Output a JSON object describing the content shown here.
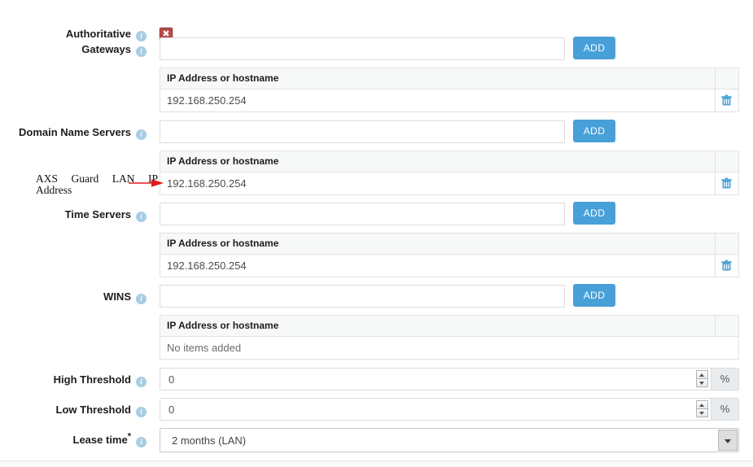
{
  "form": {
    "rows": [
      {
        "id": "authoritative",
        "label": "Authoritative",
        "type": "checkbox",
        "checked_icon": "red-x-icon",
        "accent": "#b94a48"
      },
      {
        "id": "gateways",
        "label": "Gateways",
        "type": "list",
        "input_value": "",
        "input_placeholder": "",
        "add_label": "ADD",
        "column_header": "IP Address or hostname",
        "items": [
          "192.168.250.254"
        ],
        "delete_icon": "trash-icon"
      },
      {
        "id": "domain-name-servers",
        "label": "Domain Name Servers",
        "type": "list",
        "input_value": "",
        "input_placeholder": "",
        "add_label": "ADD",
        "column_header": "IP Address or hostname",
        "items": [
          "192.168.250.254"
        ],
        "delete_icon": "trash-icon"
      },
      {
        "id": "time-servers",
        "label": "Time Servers",
        "type": "list",
        "input_value": "",
        "input_placeholder": "",
        "add_label": "ADD",
        "column_header": "IP Address or hostname",
        "items": [
          "192.168.250.254"
        ],
        "delete_icon": "trash-icon"
      },
      {
        "id": "wins",
        "label": "WINS",
        "type": "list",
        "input_value": "",
        "input_placeholder": "",
        "add_label": "ADD",
        "column_header": "IP Address or hostname",
        "items": [],
        "empty_text": "No items added",
        "delete_icon": "trash-icon"
      },
      {
        "id": "high-threshold",
        "label": "High Threshold",
        "type": "number",
        "value": "0",
        "suffix": "%"
      },
      {
        "id": "low-threshold",
        "label": "Low Threshold",
        "type": "number",
        "value": "0",
        "suffix": "%"
      },
      {
        "id": "lease-time",
        "label": "Lease time",
        "required": true,
        "type": "select",
        "selected": "2 months (LAN)"
      }
    ]
  },
  "annotation": {
    "line1": "AXS Guard LAN IP",
    "line2": "Address",
    "arrow_color": "#e01b1b"
  },
  "icons": {
    "info": "i",
    "red_x": "✖"
  },
  "colors": {
    "add_button": "#48a0d8",
    "trash": "#4da3d8",
    "info_badge": "#a7cde4",
    "table_header_bg": "#f7f8f8",
    "border": "#e2e2e2"
  }
}
